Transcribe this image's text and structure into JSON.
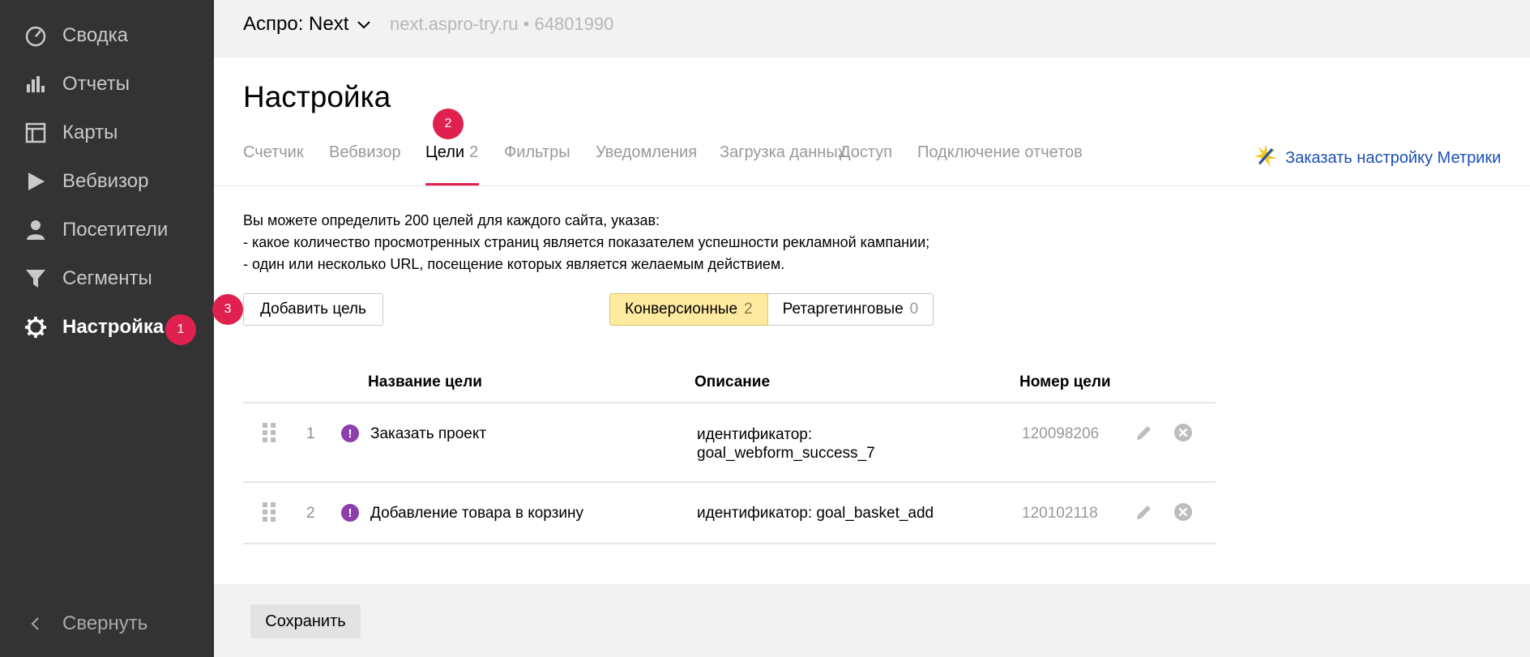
{
  "colors": {
    "sidebar_bg": "#333333",
    "accent": "#e0204f",
    "link": "#1a4fb9",
    "segment_on": "#ffeba0",
    "goal_icon": "#8a3fab"
  },
  "sidebar": {
    "items": [
      {
        "label": "Сводка",
        "icon": "gauge-icon"
      },
      {
        "label": "Отчеты",
        "icon": "bar-chart-icon"
      },
      {
        "label": "Карты",
        "icon": "layout-icon"
      },
      {
        "label": "Вебвизор",
        "icon": "play-icon"
      },
      {
        "label": "Посетители",
        "icon": "person-icon"
      },
      {
        "label": "Сегменты",
        "icon": "funnel-icon"
      },
      {
        "label": "Настройка",
        "icon": "gear-icon",
        "active": true
      }
    ],
    "collapse_label": "Свернуть",
    "collapse_icon": "chevron-left-icon"
  },
  "badges": {
    "b1": "1",
    "b2": "2",
    "b3": "3"
  },
  "topbar": {
    "project": "Аспро: Next",
    "site": "next.aspro-try.ru • 64801990"
  },
  "page": {
    "title": "Настройка"
  },
  "tabs": [
    {
      "label": "Счетчик"
    },
    {
      "label": "Вебвизор"
    },
    {
      "label": "Цели",
      "count": "2",
      "active": true
    },
    {
      "label": "Фильтры"
    },
    {
      "label": "Уведомления"
    },
    {
      "label": "Загрузка данных"
    },
    {
      "label": "Доступ"
    },
    {
      "label": "Подключение отчетов"
    }
  ],
  "order_link": {
    "label": "Заказать настройку Метрики",
    "icon": "sparkle-icon"
  },
  "info": {
    "line1": "Вы можете определить 200 целей для каждого сайта, указав:",
    "line2": "-  какое количество просмотренных страниц является показателем успешности рекламной кампании;",
    "line3": "-  один или несколько URL, посещение которых является желаемым действием."
  },
  "add_goal_button": "Добавить цель",
  "segments": [
    {
      "label": "Конверсионные",
      "count": "2",
      "selected": true
    },
    {
      "label": "Ретаргетинговые",
      "count": "0",
      "selected": false
    }
  ],
  "table": {
    "headers": {
      "name": "Название цели",
      "description": "Описание",
      "number": "Номер цели"
    },
    "rows": [
      {
        "index": "1",
        "name": "Заказать проект",
        "desc_line1": "идентификатор:",
        "desc_line2": "goal_webform_success_7",
        "goal_id": "120098206"
      },
      {
        "index": "2",
        "name": "Добавление товара в корзину",
        "desc_line1": "идентификатор: goal_basket_add",
        "desc_line2": "",
        "goal_id": "120102118"
      }
    ]
  },
  "footer": {
    "save_label": "Сохранить"
  }
}
